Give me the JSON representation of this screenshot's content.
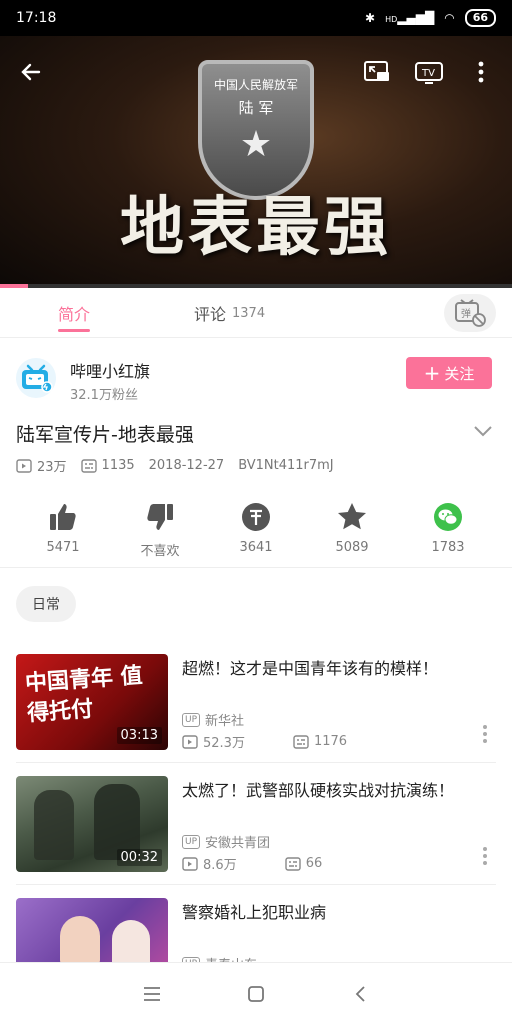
{
  "status_bar": {
    "time": "17:18",
    "battery": "66",
    "network": "HD"
  },
  "video": {
    "emblem_line1": "中国人民解放军",
    "emblem_line2": "陆 军",
    "overlay_title": "地表最强"
  },
  "tabs": [
    {
      "label": "简介",
      "count": ""
    },
    {
      "label": "评论",
      "count": "1374"
    }
  ],
  "uploader": {
    "name": "哔哩小红旗",
    "fans": "32.1万粉丝",
    "follow_label": "关注"
  },
  "title": "陆军宣传片-地表最强",
  "meta": {
    "views": "23万",
    "danmaku": "1135",
    "date": "2018-12-27",
    "bvid": "BV1Nt411r7mJ"
  },
  "actions": [
    {
      "name": "like",
      "label": "5471"
    },
    {
      "name": "dislike",
      "label": "不喜欢"
    },
    {
      "name": "coin",
      "label": "3641"
    },
    {
      "name": "favorite",
      "label": "5089"
    },
    {
      "name": "share-wechat",
      "label": "1783"
    }
  ],
  "tag": "日常",
  "related": [
    {
      "title": "超燃！这才是中国青年该有的模样！",
      "uploader": "新华社",
      "views": "52.3万",
      "danmaku": "1176",
      "duration": "03:13",
      "thumb_text": "中国青年 值得托付"
    },
    {
      "title": "太燃了！武警部队硬核实战对抗演练！",
      "uploader": "安徽共青团",
      "views": "8.6万",
      "danmaku": "66",
      "duration": "00:32"
    },
    {
      "title": "警察婚礼上犯职业病",
      "uploader": "青春山东",
      "views": "",
      "danmaku": "",
      "duration": ""
    }
  ],
  "icons": {
    "up_badge": "UP"
  },
  "colors": {
    "accent": "#fb7299",
    "wechat": "#3ec14b"
  }
}
